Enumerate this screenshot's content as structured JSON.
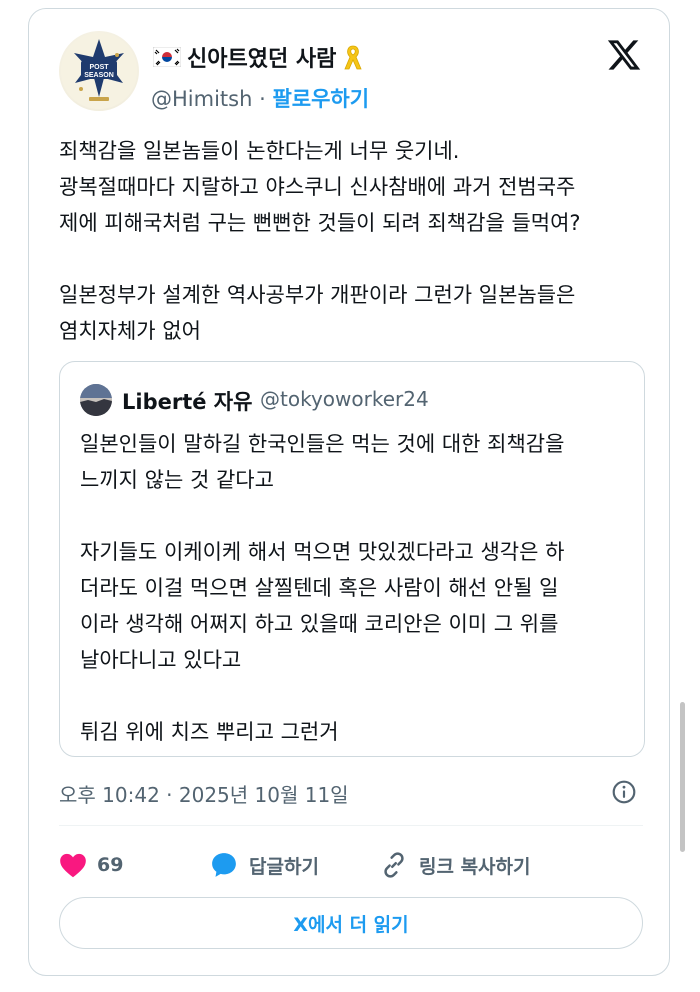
{
  "author": {
    "display_name": "신아트였던 사람",
    "handle": "@Himitsh",
    "separator": "·",
    "follow_label": "팔로우하기",
    "avatar_text": "POST SEASON"
  },
  "tweet": {
    "text": "죄책감을 일본놈들이 논한다는게 너무 웃기네.\n광복절때마다 지랄하고 야스쿠니 신사참배에 과거 전범국주\n제에 피해국처럼 구는 뻔뻔한 것들이 되려 죄책감을 들먹여?\n\n일본정부가 설계한 역사공부가 개판이라 그런가 일본놈들은\n염치자체가 없어",
    "timestamp": "오후 10:42 · 2025년 10월 11일"
  },
  "quoted": {
    "display_name": "Liberté 자유",
    "handle": "@tokyoworker24",
    "text": "일본인들이 말하길 한국인들은 먹는 것에 대한 죄책감을\n느끼지 않는 것 같다고\n\n자기들도 이케이케 해서 먹으면 맛있겠다라고 생각은 하\n더라도 이걸 먹으면 살찔텐데 혹은 사람이 해선 안될 일\n이라 생각해 어쩌지 하고 있을때 코리안은 이미 그 위를\n날아다니고 있다고\n\n튀김 위에 치즈 뿌리고 그런거"
  },
  "actions": {
    "like_count": "69",
    "reply_label": "답글하기",
    "copy_link_label": "링크 복사하기"
  },
  "read_more_label": "X에서 더 읽기",
  "colors": {
    "accent": "#1d9bf0",
    "like": "#f91880",
    "text": "#0f1419",
    "secondary": "#536471",
    "border": "#cfd9de"
  },
  "icons": {
    "brand": "x-logo-icon",
    "like": "heart-icon",
    "reply": "speech-bubble-icon",
    "copy_link": "link-icon",
    "info": "info-icon",
    "flag": "korea-flag-icon",
    "ribbon": "yellow-ribbon-icon"
  }
}
